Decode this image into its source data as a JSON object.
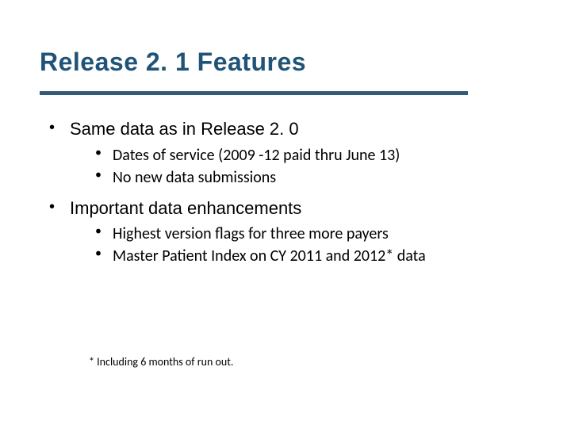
{
  "title": "Release 2. 1 Features",
  "bullets": [
    {
      "text": "Same data as in Release 2. 0",
      "sub": [
        "Dates of service (2009 -12 paid thru June 13)",
        "No new data submissions"
      ]
    },
    {
      "text": "Important data enhancements",
      "sub": [
        "Highest version flags for three more payers",
        "Master Patient Index on CY 2011 and 2012* data"
      ]
    }
  ],
  "footnote": "* Including 6 months of run out."
}
